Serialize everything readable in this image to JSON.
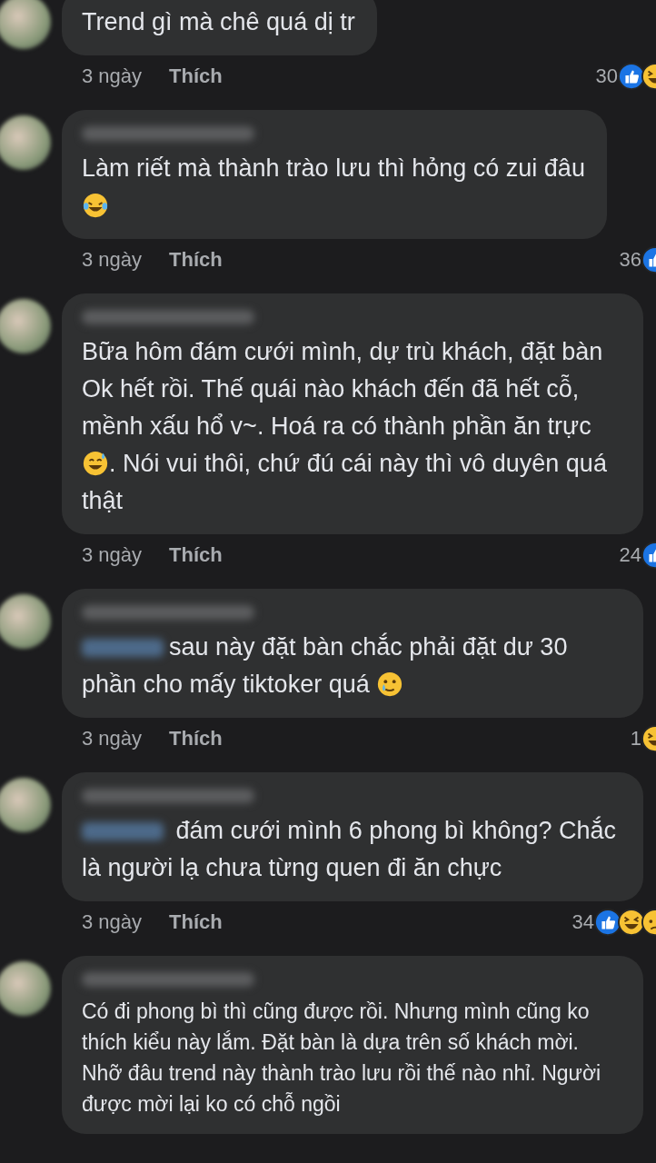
{
  "comments": [
    {
      "body": [
        {
          "kind": "text",
          "text": "Trend gì mà chê quá dị tr"
        }
      ],
      "time": "3 ngày",
      "like_label": "Thích",
      "reaction_count": "30",
      "reactions": [
        {
          "kind": "like"
        },
        {
          "kind": "haha"
        }
      ]
    },
    {
      "author_blurred": true,
      "body": [
        {
          "kind": "text",
          "text": "Làm riết mà thành trào lưu thì hỏng có zui đâu"
        },
        {
          "kind": "break"
        },
        {
          "kind": "laugh-tears"
        }
      ],
      "time": "3 ngày",
      "like_label": "Thích",
      "reaction_count": "36",
      "reactions": [
        {
          "kind": "like"
        }
      ]
    },
    {
      "author_blurred": true,
      "body": [
        {
          "kind": "text",
          "text": "Bữa hôm đám cưới mình, dự  trù khách, đặt bàn Ok hết rồi. Thế quái nào khách đến đã hết cỗ, mềnh xấu hổ v~. Hoá ra có thành phần ăn trực"
        },
        {
          "kind": "break"
        },
        {
          "kind": "sweat-smile"
        },
        {
          "kind": "text",
          "text": ". Nói vui thôi, chứ  đú cái này thì vô duyên quá thật"
        }
      ],
      "time": "3 ngày",
      "like_label": "Thích",
      "reaction_count": "24",
      "reactions": [
        {
          "kind": "like"
        }
      ]
    },
    {
      "author_blurred": true,
      "body": [
        {
          "kind": "mention"
        },
        {
          "kind": "text",
          "text": "sau này đặt bàn chắc phải đặt dư 30 phần cho mấy tiktoker quá "
        },
        {
          "kind": "tear-smile"
        }
      ],
      "time": "3 ngày",
      "like_label": "Thích",
      "reaction_count": "1",
      "reactions": [
        {
          "kind": "haha"
        }
      ]
    },
    {
      "author_blurred": true,
      "body": [
        {
          "kind": "mention"
        },
        {
          "kind": "text",
          "text": " đám cưới mình 6 phong bì không? Chắc là người lạ chưa từng quen đi ăn chực"
        }
      ],
      "time": "3 ngày",
      "like_label": "Thích",
      "reaction_count": "34",
      "reactions": [
        {
          "kind": "like"
        },
        {
          "kind": "haha"
        },
        {
          "kind": "sad"
        }
      ]
    },
    {
      "author_blurred": true,
      "body": [
        {
          "kind": "text",
          "text": "Có đi phong bì thì cũng được rồi. Nhưng mình cũng ko thích kiểu này lắm. Đặt bàn là dựa trên số khách mời. Nhỡ đâu trend này thành trào lưu rồi thế nào nhỉ. Người được mời lại ko có chỗ ngồi"
        }
      ]
    }
  ]
}
